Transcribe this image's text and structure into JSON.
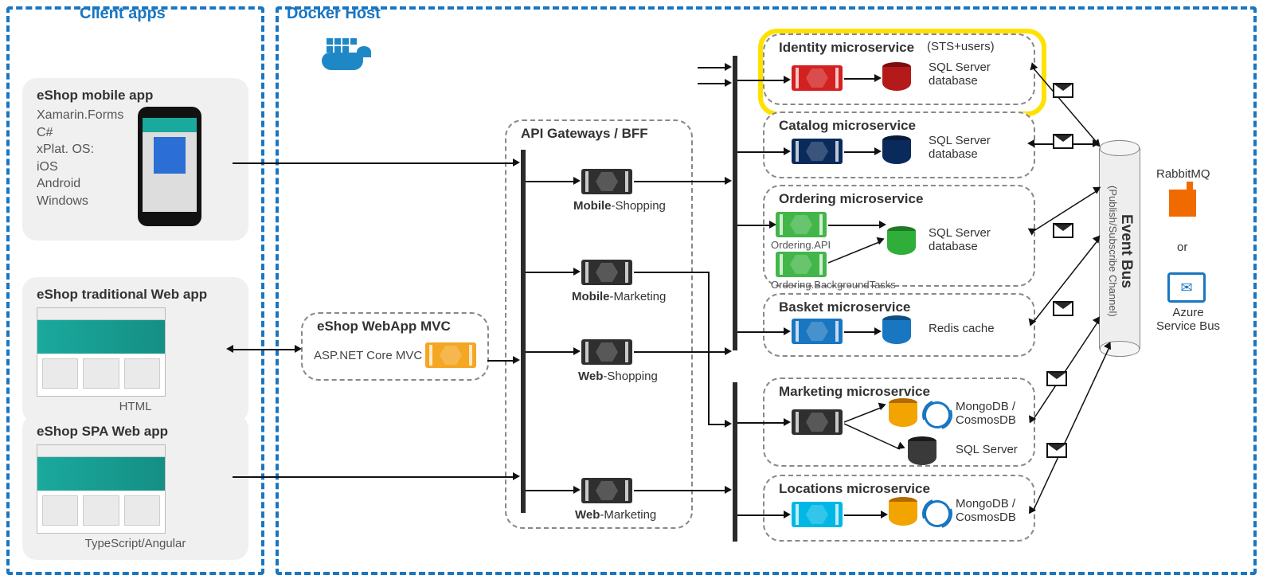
{
  "regions": {
    "clients_title": "Client apps",
    "docker_title": "Docker Host"
  },
  "clients": {
    "mobile": {
      "title": "eShop mobile app",
      "text": "Xamarin.Forms\nC#\nxPlat. OS:\n  iOS\n  Android\n  Windows"
    },
    "traditional": {
      "title": "eShop traditional Web app",
      "caption": "HTML"
    },
    "spa": {
      "title": "eShop SPA Web app",
      "caption": "TypeScript/Angular"
    }
  },
  "webapp_mvc": {
    "title": "eShop WebApp MVC",
    "text": "ASP.NET Core MVC"
  },
  "api_gateways": {
    "title": "API Gateways / BFF",
    "mobile_shopping_b": "Mobile",
    "mobile_shopping": "-Shopping",
    "mobile_marketing_b": "Mobile",
    "mobile_marketing": "-Marketing",
    "web_shopping_b": "Web",
    "web_shopping": "-Shopping",
    "web_marketing_b": "Web",
    "web_marketing": "-Marketing"
  },
  "microservices": {
    "identity": {
      "title": "Identity microservice",
      "subtitle": "(STS+users)",
      "db": "SQL Server\ndatabase"
    },
    "catalog": {
      "title": "Catalog microservice",
      "db": "SQL Server\ndatabase"
    },
    "ordering": {
      "title": "Ordering microservice",
      "api": "Ordering.API",
      "bg": "Ordering.BackgroundTasks",
      "db": "SQL Server\ndatabase"
    },
    "basket": {
      "title": "Basket microservice",
      "db": "Redis cache"
    },
    "marketing": {
      "title": "Marketing microservice",
      "db1": "MongoDB /\nCosmosDB",
      "db2": "SQL Server"
    },
    "locations": {
      "title": "Locations microservice",
      "db": "MongoDB /\nCosmosDB"
    }
  },
  "eventbus": {
    "title": "Event Bus",
    "subtitle": "(Publish/Subscribe Channel)",
    "rabbit": "RabbitMQ",
    "or": "or",
    "asb": "Azure\nService Bus"
  }
}
